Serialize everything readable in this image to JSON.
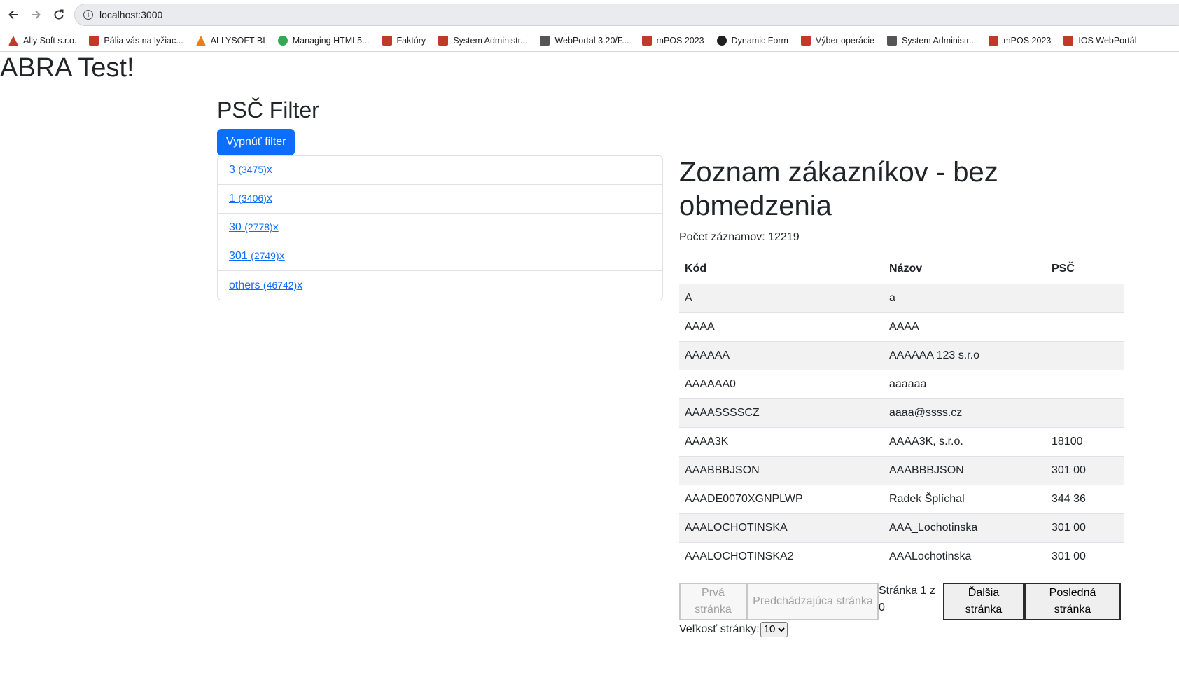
{
  "browser": {
    "url": "localhost:3000",
    "bookmarks": [
      {
        "label": "Ally Soft s.r.o.",
        "icon": "ally-icon",
        "color": "#c0392b"
      },
      {
        "label": "Pália vás na lyžiac...",
        "icon": "pdf-icon",
        "color": "#c0392b"
      },
      {
        "label": "ALLYSOFT BI",
        "icon": "bi-icon",
        "color": "#e67e22"
      },
      {
        "label": "Managing HTML5...",
        "icon": "chrome-icon",
        "color": "#34a853"
      },
      {
        "label": "Faktúry",
        "icon": "invoice-icon",
        "color": "#c0392b"
      },
      {
        "label": "System Administr...",
        "icon": "admin-icon",
        "color": "#c0392b"
      },
      {
        "label": "WebPortal 3.20/F...",
        "icon": "webportal-icon",
        "color": "#555555"
      },
      {
        "label": "mPOS 2023",
        "icon": "mpos-icon",
        "color": "#c0392b"
      },
      {
        "label": "Dynamic Form",
        "icon": "github-icon",
        "color": "#1f1f1f"
      },
      {
        "label": "Výber operácie",
        "icon": "operation-icon",
        "color": "#c0392b"
      },
      {
        "label": "System Administr...",
        "icon": "admin-icon",
        "color": "#555555"
      },
      {
        "label": "mPOS 2023",
        "icon": "mpos-icon",
        "color": "#c0392b"
      },
      {
        "label": "IOS WebPortál",
        "icon": "ios-webportal-icon",
        "color": "#c0392b"
      }
    ]
  },
  "app": {
    "title": "ABRA Test!"
  },
  "filter": {
    "title": "PSČ Filter",
    "toggle_label": "Vypnúť filter",
    "items": [
      {
        "label": "3",
        "count": "(3475)",
        "suffix": "x"
      },
      {
        "label": "1",
        "count": "(3406)",
        "suffix": "x"
      },
      {
        "label": "30",
        "count": "(2778)",
        "suffix": "x"
      },
      {
        "label": "301",
        "count": "(2749)",
        "suffix": "x"
      },
      {
        "label": "others",
        "count": "(46742)",
        "suffix": "x"
      }
    ]
  },
  "list": {
    "title": "Zoznam zákazníkov - bez obmedzenia",
    "record_count": "Počet záznamov: 12219",
    "columns": [
      "Kód",
      "Názov",
      "PSČ"
    ],
    "rows": [
      [
        "A",
        "a",
        ""
      ],
      [
        "AAAA",
        "AAAA",
        ""
      ],
      [
        "AAAAAA",
        "AAAAAA 123 s.r.o",
        ""
      ],
      [
        "AAAAAA0",
        "aaaaaa",
        ""
      ],
      [
        "AAAASSSSCZ",
        "aaaa@ssss.cz",
        ""
      ],
      [
        "AAAA3K",
        "AAAA3K, s.r.o.",
        "18100"
      ],
      [
        "AAABBBJSON",
        "AAABBBJSON",
        "301 00"
      ],
      [
        "AAADE0070XGNPLWP",
        "Radek Šplíchal",
        "344 36"
      ],
      [
        "AAALOCHOTINSKA",
        "AAA_Lochotinska",
        "301 00"
      ],
      [
        "AAALOCHOTINSKA2",
        "AAALochotinska",
        "301 00"
      ]
    ]
  },
  "pagination": {
    "first": "Prvá stránka",
    "prev": "Predchádzajúca stránka",
    "page_info": "Stránka 1 z 0",
    "next": "Ďalšia stránka",
    "last": "Posledná stránka",
    "page_size_label": "Veľkosť stránky:",
    "page_size_value": "10"
  },
  "colors": {
    "accent": "#0d6efd",
    "stripe": "#f2f2f2"
  }
}
